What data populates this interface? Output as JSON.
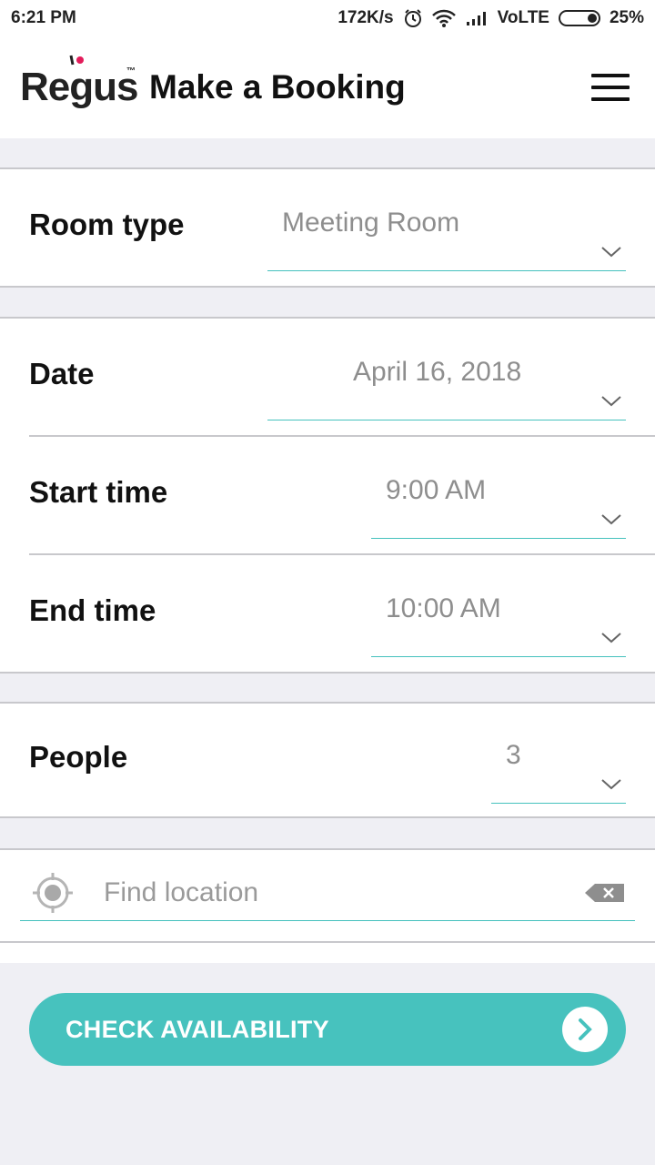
{
  "status_bar": {
    "time": "6:21 PM",
    "speed": "172K/s",
    "network": "VoLTE",
    "battery": "25%"
  },
  "header": {
    "logo_text": "Regus",
    "title": "Make a Booking",
    "brand_color": "#e31c5a"
  },
  "form": {
    "room_type": {
      "label": "Room type",
      "value": "Meeting Room"
    },
    "date": {
      "label": "Date",
      "value": "April 16, 2018"
    },
    "start_time": {
      "label": "Start time",
      "value": "9:00 AM"
    },
    "end_time": {
      "label": "End time",
      "value": "10:00 AM"
    },
    "people": {
      "label": "People",
      "value": "3"
    },
    "location": {
      "placeholder": "Find location",
      "value": ""
    }
  },
  "cta": {
    "label": "CHECK AVAILABILITY"
  },
  "colors": {
    "accent": "#47c2be",
    "background": "#efeff4",
    "divider": "#c8c8cc"
  }
}
